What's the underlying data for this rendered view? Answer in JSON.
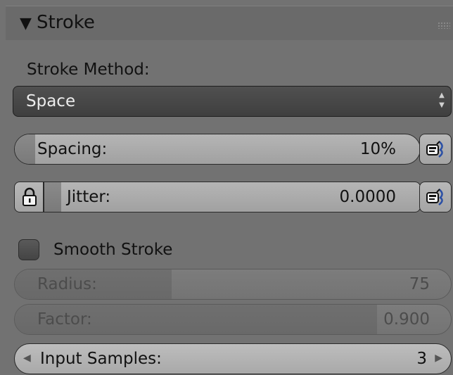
{
  "panel": {
    "title": "Stroke",
    "collapse_icon": "triangle-down-icon",
    "grip_icon": "drag-grip-icon"
  },
  "stroke_method": {
    "label": "Stroke Method:",
    "selected": "Space",
    "arrows_icon": "up-down-arrows-icon"
  },
  "spacing": {
    "label": "Spacing:",
    "value": "10%",
    "fraction": 0.05,
    "pen_icon": "tablet-pressure-icon"
  },
  "jitter": {
    "label": "Jitter:",
    "value": "0.0000",
    "lock_icon": "lock-icon",
    "pen_icon": "tablet-pressure-icon"
  },
  "smooth_stroke": {
    "label": "Smooth Stroke",
    "checked": false
  },
  "radius": {
    "label": "Radius:",
    "value": "75",
    "fraction": 0.36
  },
  "factor": {
    "label": "Factor:",
    "value": "0.900",
    "fraction": 0.83
  },
  "input_samples": {
    "label": "Input Samples:",
    "value": "3",
    "left_arrow_icon": "left-arrow-icon",
    "right_arrow_icon": "right-arrow-icon"
  },
  "colors": {
    "panel_bg": "#727272",
    "dropdown_bg": "#474747",
    "slider_bg": "#acacac",
    "slider_fill": "#828282",
    "text": "#111111",
    "disabled_text": "#4c4c4c"
  }
}
